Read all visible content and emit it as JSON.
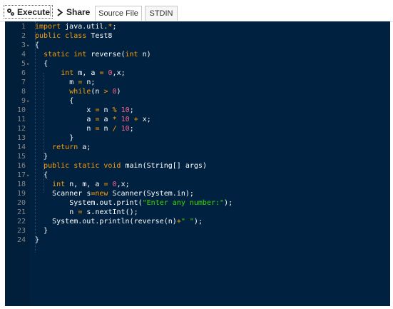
{
  "toolbar": {
    "execute_label": "Execute",
    "share_label": "Share",
    "tabs": [
      {
        "label": "Source File",
        "active": true
      },
      {
        "label": "STDIN",
        "active": false
      }
    ]
  },
  "editor": {
    "colors": {
      "background": "#002240",
      "keyword": "#ff9d00",
      "string": "#3ad900",
      "number": "#ff628c",
      "text": "#ffffff",
      "gutter": "#888888"
    },
    "lines": [
      {
        "n": "1",
        "fold": false,
        "text": "import java.util.*;"
      },
      {
        "n": "2",
        "fold": false,
        "text": "public class Test8"
      },
      {
        "n": "3",
        "fold": true,
        "text": "{"
      },
      {
        "n": "4",
        "fold": false,
        "text": "  static int reverse(int n)"
      },
      {
        "n": "5",
        "fold": true,
        "text": "  {"
      },
      {
        "n": "6",
        "fold": false,
        "text": "      int m, a = 0,x;"
      },
      {
        "n": "7",
        "fold": false,
        "text": "        m = n;"
      },
      {
        "n": "8",
        "fold": false,
        "text": "        while(n > 0)"
      },
      {
        "n": "9",
        "fold": true,
        "text": "        {"
      },
      {
        "n": "10",
        "fold": false,
        "text": "            x = n % 10;"
      },
      {
        "n": "11",
        "fold": false,
        "text": "            a = a * 10 + x;"
      },
      {
        "n": "12",
        "fold": false,
        "text": "            n = n / 10;"
      },
      {
        "n": "13",
        "fold": false,
        "text": "        }"
      },
      {
        "n": "14",
        "fold": false,
        "text": "    return a;"
      },
      {
        "n": "15",
        "fold": false,
        "text": "  }"
      },
      {
        "n": "16",
        "fold": false,
        "text": "  public static void main(String[] args)"
      },
      {
        "n": "17",
        "fold": true,
        "text": "  {"
      },
      {
        "n": "18",
        "fold": false,
        "text": "    int n, m, a = 0,x;"
      },
      {
        "n": "19",
        "fold": false,
        "text": "    Scanner s=new Scanner(System.in);"
      },
      {
        "n": "20",
        "fold": false,
        "text": "        System.out.print(\"Enter any number:\");"
      },
      {
        "n": "21",
        "fold": false,
        "text": "        n = s.nextInt();"
      },
      {
        "n": "22",
        "fold": false,
        "text": "    System.out.println(reverse(n)+\" \");"
      },
      {
        "n": "23",
        "fold": false,
        "text": "  }"
      },
      {
        "n": "24",
        "fold": false,
        "text": "}"
      }
    ]
  }
}
